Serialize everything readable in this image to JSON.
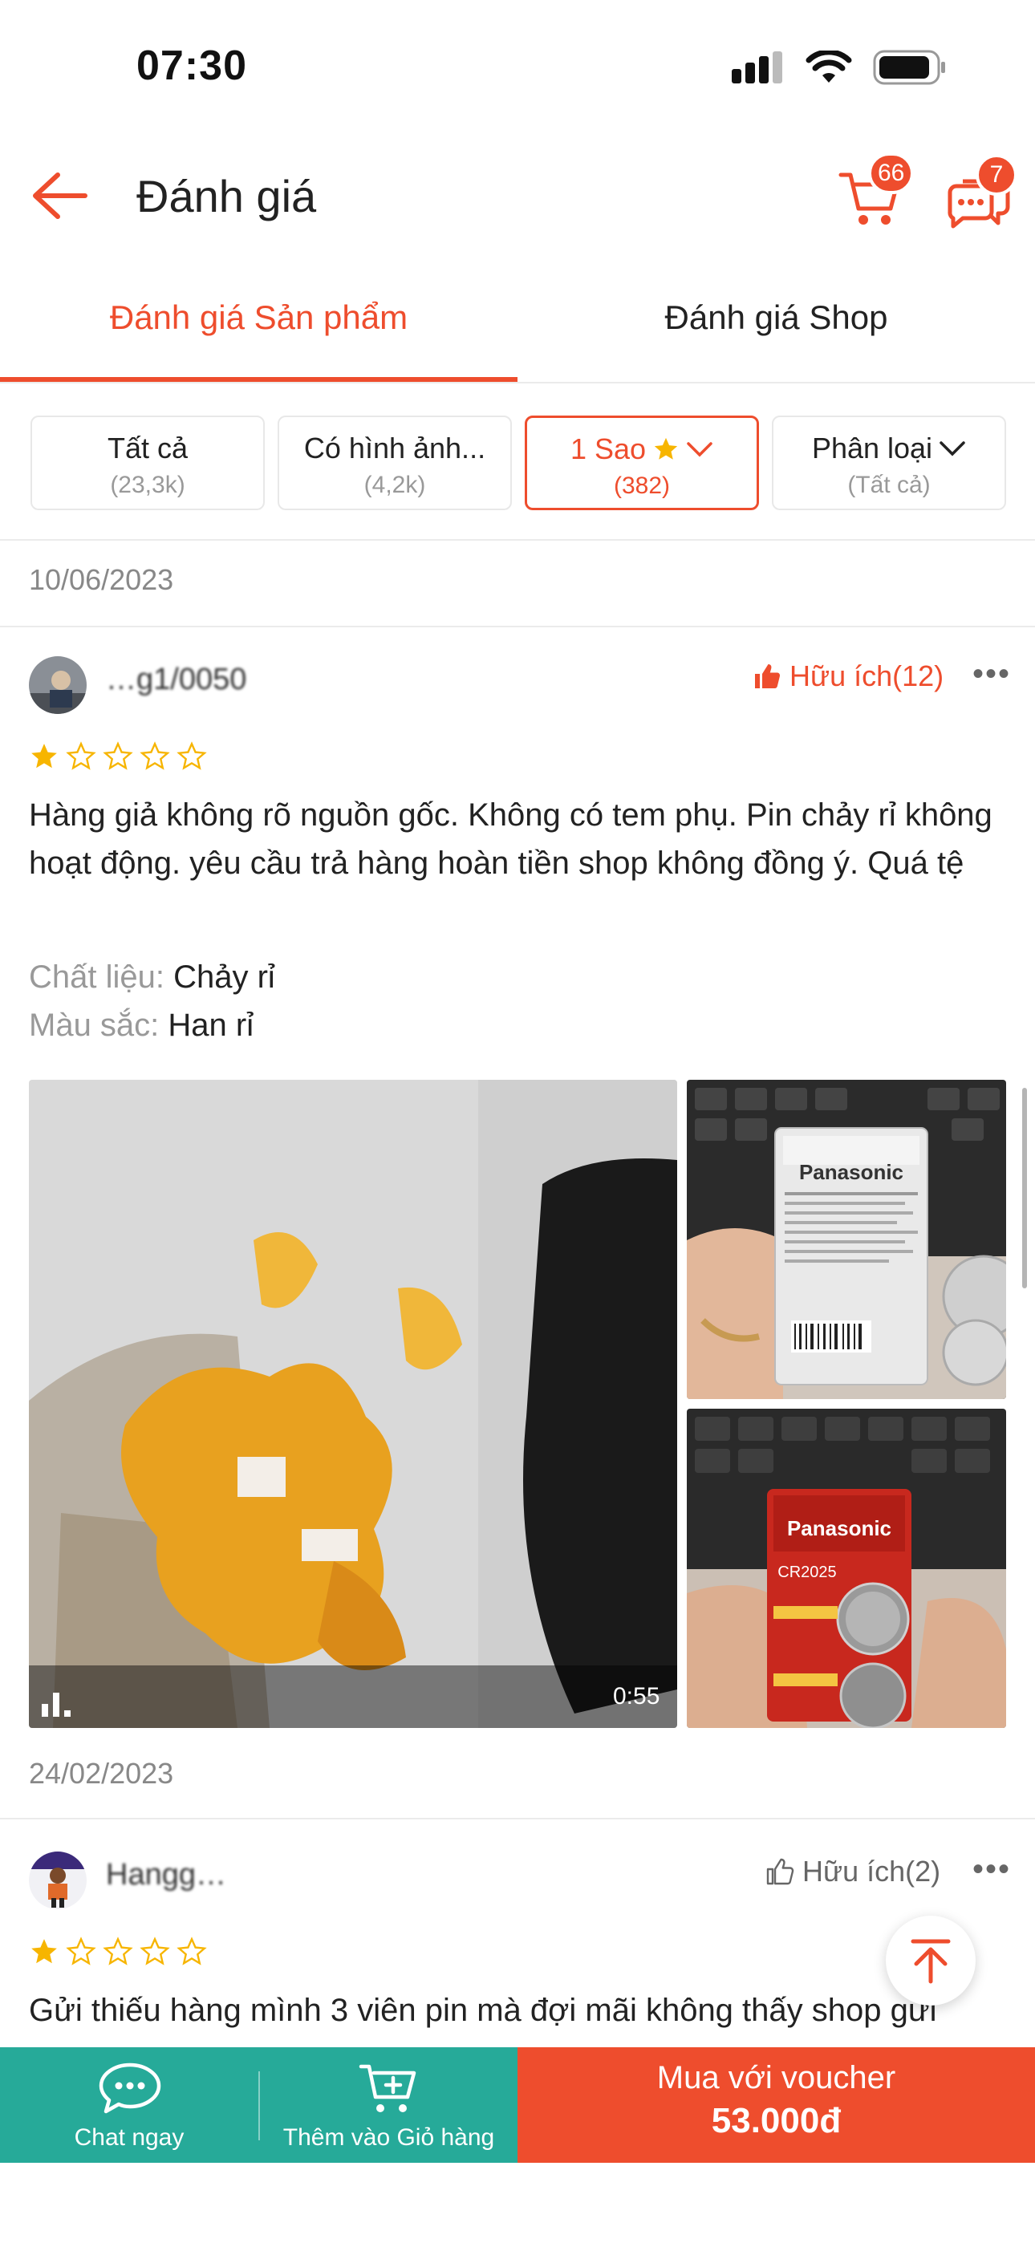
{
  "status_bar": {
    "time": "07:30"
  },
  "header": {
    "title": "Đánh giá",
    "cart_badge": "66",
    "chat_badge": "7"
  },
  "tabs": [
    {
      "label": "Đánh giá Sản phẩm",
      "active": true
    },
    {
      "label": "Đánh giá Shop",
      "active": false
    }
  ],
  "filters": [
    {
      "label": "Tất cả",
      "count": "(23,3k)"
    },
    {
      "label": "Có hình ảnh...",
      "count": "(4,2k)"
    },
    {
      "label": "1 Sao",
      "count": "(382)",
      "active": true
    },
    {
      "label": "Phân loại",
      "count": "(Tất cả)"
    }
  ],
  "reviews": [
    {
      "date": "10/06/2023",
      "username": "…g1/0050",
      "helpful": "Hữu ích(12)",
      "helpful_active": true,
      "rating": 1,
      "text": "Hàng giả không rõ nguồn gốc. Không có tem phụ. Pin chảy rỉ không hoạt động. yêu cầu trả hàng hoàn tiền shop không đồng ý. Quá tệ",
      "attributes": [
        {
          "key": "Chất liệu:",
          "value": "Chảy rỉ"
        },
        {
          "key": "Màu sắc:",
          "value": "Han rỉ"
        }
      ],
      "video_duration": "0:55",
      "photo_brand_1": "Panasonic",
      "photo_brand_2": "Panasonic",
      "photo_model": "CR2025"
    },
    {
      "date": "24/02/2023",
      "username": "Hangg…",
      "helpful": "Hữu ích(2)",
      "helpful_active": false,
      "rating": 1,
      "text": "Gửi thiếu hàng mình 3 viên pin mà đợi mãi không thấy shop gửi"
    }
  ],
  "bottom_bar": {
    "chat_label": "Chat ngay",
    "cart_label": "Thêm vào Giỏ hàng",
    "buy_line1": "Mua với voucher",
    "buy_line2": "53.000đ"
  },
  "colors": {
    "accent": "#ee4d2d",
    "teal": "#26aa99",
    "star": "#f7b500"
  }
}
